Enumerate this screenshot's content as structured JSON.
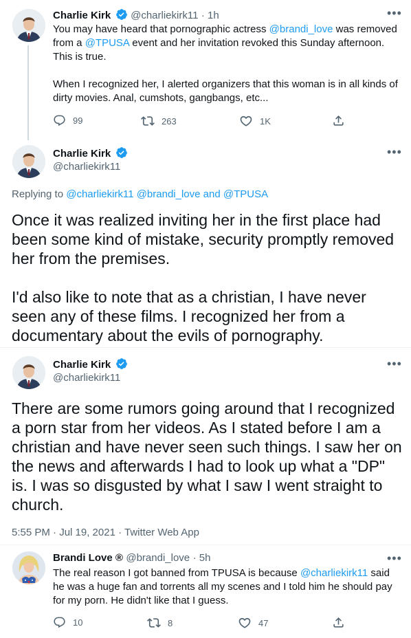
{
  "tweet1": {
    "name": "Charlie Kirk",
    "handle": "@charliekirk11",
    "time": "· 1h",
    "text_a1": "You may have heard that pornographic actress ",
    "mention_a": "@brandi_love",
    "text_a2": " was removed from a ",
    "mention_b": "@TPUSA",
    "text_a3": " event and her invitation revoked this Sunday afternoon. This is true.",
    "text_b": "When I recognized her, I alerted organizers that this woman is in all kinds of dirty movies. Anal, cumshots, gangbangs, etc...",
    "replies": "99",
    "retweets": "263",
    "likes": "1K"
  },
  "tweet2": {
    "name": "Charlie Kirk",
    "handle": "@charliekirk11",
    "replying_prefix": "Replying to ",
    "replying_to": "@charliekirk11 @brandi_love and @TPUSA",
    "para1": "Once it was realized inviting her in the first place had been some kind of mistake, security promptly removed her from the premises.",
    "para2": "I'd also like to note that as a christian, I have never seen any of these films. I recognized her from a documentary about the evils of pornography."
  },
  "tweet3": {
    "name": "Charlie Kirk",
    "handle": "@charliekirk11",
    "text": "There are some rumors going around that I recognized a porn star from her videos. As I stated before I am a christian and have never seen such things. I saw her on the news and afterwards I had to look up what a \"DP\" is. I was so disgusted by what I saw I went straight to church.",
    "timestamp": "5:55 PM · Jul 19, 2021 · Twitter Web App"
  },
  "tweet4": {
    "name": "Brandi Love ®",
    "handle": "@brandi_love",
    "time": "· 5h",
    "text1": "The real reason I got banned from TPUSA is because ",
    "mention": "@charliekirk11",
    "text2": " said he was a huge fan and torrents all my scenes and I told him he should pay for my porn. He didn't like that I guess.",
    "replies": "10",
    "retweets": "8",
    "likes": "47"
  },
  "icons": {
    "more": "more-horizontal-icon",
    "verified": "verified-badge-icon",
    "reply": "reply-icon",
    "retweet": "retweet-icon",
    "like": "heart-icon",
    "share": "share-icon"
  },
  "colors": {
    "accent": "#1d9bf0",
    "secondary_text": "#536471",
    "thread_line": "#cfd9de"
  }
}
